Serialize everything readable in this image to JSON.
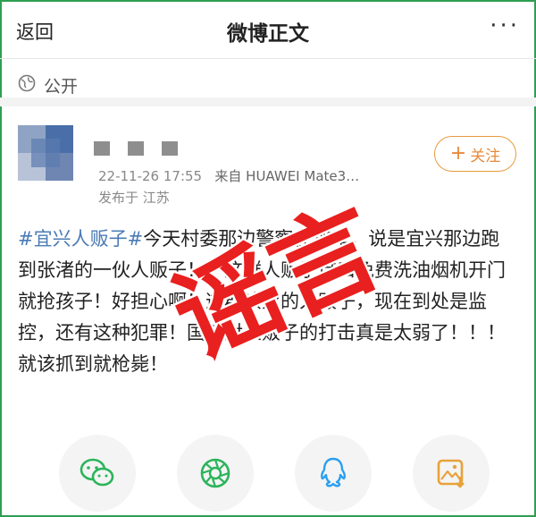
{
  "nav": {
    "back_label": "返回",
    "title": "微博正文",
    "more_label": "···"
  },
  "visibility": {
    "label": "公开",
    "icon": "globe-icon"
  },
  "post": {
    "timestamp": "22-11-26 17:55",
    "source": "来自 HUAWEI Mate3…",
    "location": "发布于 江苏",
    "follow_plus": "+",
    "follow_label": "关注",
    "hashtag": "#宜兴人贩子#",
    "body_text": "今天村委那边警察在查车，说是宜兴那边跑到张渚的一伙人贩子！！这群人贩子借口免费洗油烟机开门就抢孩子！好担心啊！这群该死的人贩子，现在到处是监控，还有这种犯罪！国家对人贩子的打击真是太弱了！！！就该抓到就枪毙！"
  },
  "stamp": {
    "text": "谣言",
    "color": "#e8201f"
  },
  "share_icons": [
    "wechat-icon",
    "moments-icon",
    "qq-icon",
    "save-image-icon"
  ],
  "colors": {
    "accent_orange": "#e8893a",
    "hashtag_blue": "#4a7bb5",
    "frame_green": "#2f9e52"
  }
}
